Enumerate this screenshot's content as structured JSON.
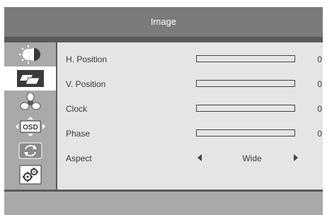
{
  "header": {
    "title": "Image"
  },
  "sidebar": {
    "items": [
      {
        "icon": "brightness-contrast-icon",
        "active": false
      },
      {
        "icon": "image-setup-icon",
        "active": true
      },
      {
        "icon": "color-balance-icon",
        "active": false
      },
      {
        "icon": "osd-setup-icon",
        "label": "OSD",
        "active": false
      },
      {
        "icon": "reset-icon",
        "active": false
      },
      {
        "icon": "settings-gears-icon",
        "active": false
      }
    ]
  },
  "menu": {
    "items": [
      {
        "label": "H. Position",
        "type": "bar",
        "value": "0",
        "level": 0
      },
      {
        "label": "V. Position",
        "type": "bar",
        "value": "0",
        "level": 0
      },
      {
        "label": "Clock",
        "type": "bar",
        "value": "0",
        "level": 0
      },
      {
        "label": "Phase",
        "type": "bar",
        "value": "0",
        "level": 0
      },
      {
        "label": "Aspect",
        "type": "select",
        "selected": "Wide"
      }
    ]
  },
  "colors": {
    "title_bar": "#7b7b7b",
    "panel": "#e5e5e5",
    "frame": "#a9a9a9",
    "active_item": "#ffffff"
  }
}
